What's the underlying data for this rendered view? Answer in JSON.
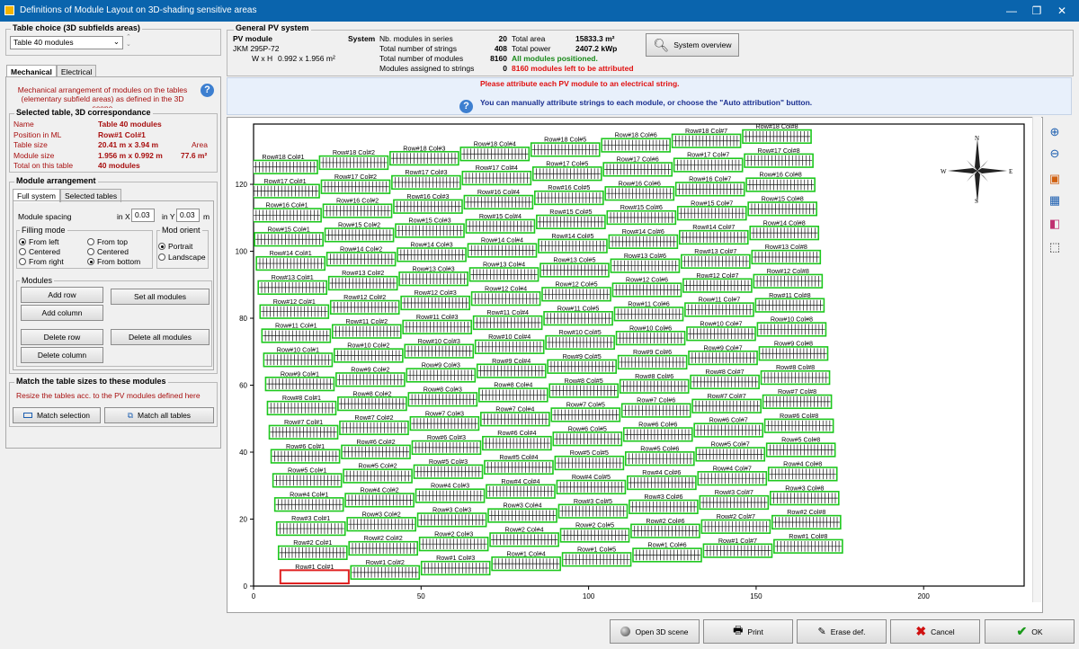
{
  "window": {
    "title": "Definitions of Module Layout on 3D-shading sensitive areas",
    "min": "—",
    "restore": "❐",
    "close": "✕"
  },
  "table_choice": {
    "title": "Table choice  (3D subfields areas)",
    "value": "Table 40 modules"
  },
  "tabs": {
    "mechanical": "Mechanical",
    "electrical": "Electrical"
  },
  "mech_desc": {
    "line1": "Mechanical arrangement of modules on the tables",
    "line2": "(elementary subfield areas) as defined in the 3D scene"
  },
  "selected_table": {
    "title": "Selected table, 3D correspondance",
    "rows": [
      {
        "label": "Name",
        "value": "Table 40 modules"
      },
      {
        "label": "Position in ML",
        "value": "Row#1 Col#1"
      },
      {
        "label": "Table size",
        "value": "20.41 m x 3.94 m"
      },
      {
        "label": "Module size",
        "value": "1.956 m x 0.992 m"
      },
      {
        "label": "Total on this table",
        "value": "40 modules"
      }
    ],
    "area_label": "Area",
    "area_value": "77.6 m²"
  },
  "module_arrangement": {
    "title": "Module arrangement",
    "tab_full": "Full system",
    "tab_selected": "Selected tables",
    "spacing_label": "Module spacing",
    "in_x_label": "in X",
    "in_x_value": "0.03",
    "in_y_label": "in Y",
    "in_y_value": "0.03",
    "unit": "m",
    "filling_title": "Filling mode",
    "fill_from_left": "From left",
    "fill_centered_h": "Centered",
    "fill_from_right": "From right",
    "fill_from_top": "From top",
    "fill_centered_v": "Centered",
    "fill_from_bottom": "From bottom",
    "orient_title": "Mod orient",
    "portrait": "Portrait",
    "landscape": "Landscape",
    "modules_title": "Modules",
    "add_row": "Add row",
    "add_column": "Add column",
    "delete_row": "Delete row",
    "delete_column": "Delete column",
    "set_all": "Set all modules",
    "delete_all": "Delete all modules"
  },
  "match": {
    "title": "Match the table sizes to these modules",
    "desc": "Resize the tables acc. to the PV modules defined here",
    "match_selection": "Match selection",
    "match_all": "Match all tables"
  },
  "pv_system": {
    "title": "General PV system",
    "pv_module_label": "PV module",
    "module_name": "JKM 295P-72",
    "wxh_label": "W x H",
    "wxh_value": "0.992 x 1.956 m²",
    "system_label": "System",
    "rows": [
      {
        "label": "Nb. modules in series",
        "value": "20"
      },
      {
        "label": "Total number of strings",
        "value": "408"
      },
      {
        "label": "Total number of modules",
        "value": "8160"
      },
      {
        "label": "Modules assigned to strings",
        "value": "0"
      }
    ],
    "area_label": "Total area",
    "area_value": "15833.3 m²",
    "power_label": "Total power",
    "power_value": "2407.2 kWp",
    "status_positioned": "All modules positioned.",
    "status_left": "8160 modules left to be attributed",
    "overview_button": "System overview"
  },
  "messages": {
    "line1": "Please attribute each PV module to an electrical string.",
    "line2": "You can manually attribute strings to each module, or choose the \"Auto attribution\" button."
  },
  "compass": {
    "n": "N",
    "s": "S",
    "e": "E",
    "w": "W"
  },
  "chart_data": {
    "type": "scatter",
    "xlim": [
      0,
      230
    ],
    "ylim": [
      0,
      138
    ],
    "xticks": [
      0,
      50,
      100,
      150,
      200
    ],
    "yticks": [
      0,
      20,
      40,
      60,
      80,
      100,
      120
    ],
    "rows": 18,
    "cols": 8,
    "table_width": 20.41,
    "table_height": 3.94,
    "selected": "Row#1 Col#1",
    "tables_x_start": [
      8,
      29,
      50,
      71,
      92,
      113,
      134,
      155
    ],
    "tables_y_base": [
      3.5,
      8.5,
      11,
      14,
      18.2,
      22,
      26.5,
      31,
      35.3,
      39.7,
      44.3,
      48.5,
      53,
      57.4,
      61.8,
      66.4,
      70.8,
      75.3
    ],
    "row_spacing": 7.2,
    "row_shift_x": -0.55,
    "col_shift_y": 1.3,
    "label_format": "Row#{r} Col#{c}"
  },
  "toolbar": {
    "zoom_in": "zoom-in",
    "zoom_out": "zoom-out"
  },
  "footer": {
    "open3d": "Open 3D scene",
    "print": "Print",
    "erase": "Erase def.",
    "cancel": "Cancel",
    "ok": "OK"
  }
}
